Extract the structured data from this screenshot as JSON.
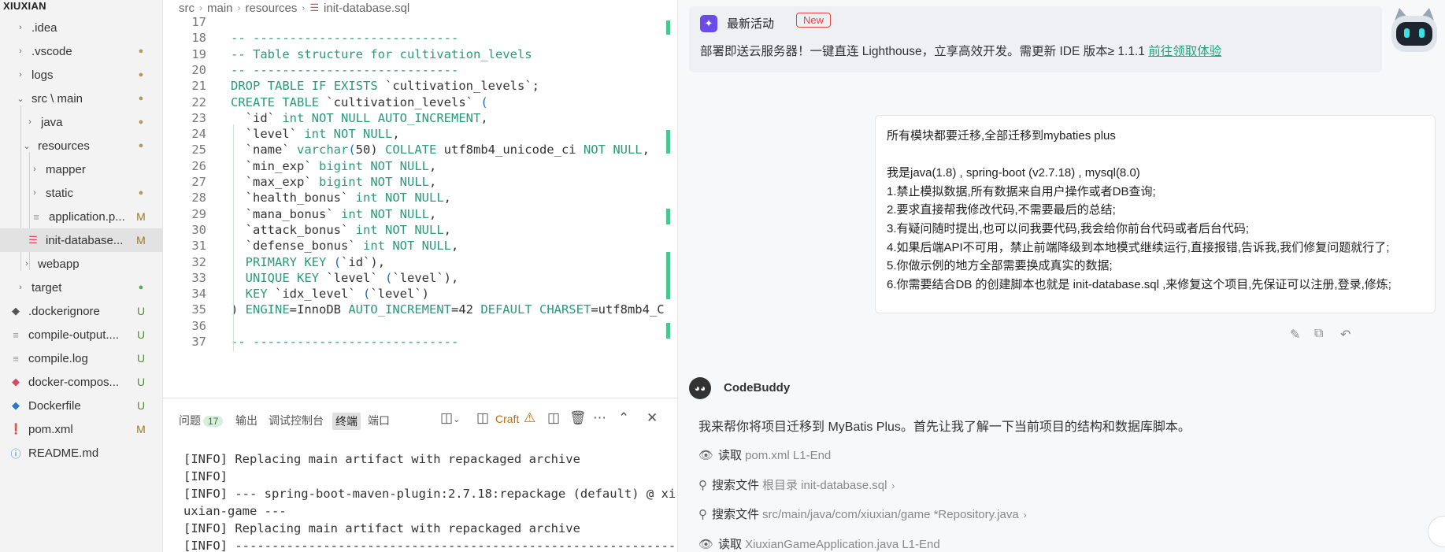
{
  "sidebar": {
    "project_title": "XIUXIAN",
    "items": [
      {
        "label": ".idea",
        "chevron": "›",
        "status": ""
      },
      {
        "label": ".vscode",
        "chevron": "›",
        "status": "●"
      },
      {
        "label": "logs",
        "chevron": "›",
        "status": "●"
      },
      {
        "label": "src \\ main",
        "chevron": "⌄",
        "status": "●"
      },
      {
        "label": "java",
        "chevron": "›",
        "status": "●"
      },
      {
        "label": "resources",
        "chevron": "⌄",
        "status": "●"
      },
      {
        "label": "mapper",
        "chevron": "›",
        "status": ""
      },
      {
        "label": "static",
        "chevron": "›",
        "status": "●"
      },
      {
        "label": "application.p...",
        "icon": "≡",
        "status": "M"
      },
      {
        "label": "init-database...",
        "icon": "≡",
        "status": "M"
      },
      {
        "label": "webapp",
        "chevron": "›",
        "status": ""
      },
      {
        "label": "target",
        "chevron": "›",
        "status": "●"
      },
      {
        "label": ".dockerignore",
        "icon": "🐳",
        "status": "U"
      },
      {
        "label": "compile-output....",
        "icon": "≡",
        "status": "U"
      },
      {
        "label": "compile.log",
        "icon": "≡",
        "status": "U"
      },
      {
        "label": "docker-compos...",
        "icon": "🐳",
        "status": "U"
      },
      {
        "label": "Dockerfile",
        "icon": "🐳",
        "status": "U"
      },
      {
        "label": "pom.xml",
        "icon": "❗",
        "status": "M"
      },
      {
        "label": "README.md",
        "icon": "ⓘ",
        "status": ""
      }
    ]
  },
  "editor": {
    "breadcrumb": [
      "src",
      "main",
      "resources",
      "init-database.sql"
    ],
    "line_numbers": [
      "17",
      "18",
      "19",
      "20",
      "21",
      "22",
      "23",
      "24",
      "25",
      "26",
      "27",
      "28",
      "29",
      "30",
      "31",
      "32",
      "33",
      "34",
      "35",
      "36",
      "37"
    ],
    "lines": [
      "",
      "-- ----------------------------",
      "-- Table structure for cultivation_levels",
      "-- ----------------------------",
      "DROP TABLE IF EXISTS `cultivation_levels`;",
      "CREATE TABLE `cultivation_levels` (",
      "  `id` int NOT NULL AUTO_INCREMENT,",
      "  `level` int NOT NULL,",
      "  `name` varchar(50) COLLATE utf8mb4_unicode_ci NOT NULL,",
      "  `min_exp` bigint NOT NULL,",
      "  `max_exp` bigint NOT NULL,",
      "  `health_bonus` int NOT NULL,",
      "  `mana_bonus` int NOT NULL,",
      "  `attack_bonus` int NOT NULL,",
      "  `defense_bonus` int NOT NULL,",
      "  PRIMARY KEY (`id`),",
      "  UNIQUE KEY `level` (`level`),",
      "  KEY `idx_level` (`level`)",
      ") ENGINE=InnoDB AUTO_INCREMENT=42 DEFAULT CHARSET=utf8mb4_C",
      "",
      "-- ----------------------------"
    ]
  },
  "panel": {
    "tabs": {
      "problems": "问题",
      "problems_count": "17",
      "output": "输出",
      "debug_console": "调试控制台",
      "terminal": "终端",
      "ports": "端口"
    },
    "craft_label": "Craft",
    "terminal_lines": [
      "[INFO] Replacing main artifact with repackaged archive",
      "[INFO]",
      "[INFO] --- spring-boot-maven-plugin:2.7.18:repackage (default) @ xi",
      "uxian-game ---",
      "[INFO] Replacing main artifact with repackaged archive",
      "[INFO] ------------------------------------------------------------"
    ]
  },
  "chat": {
    "promo": {
      "title": "最新活动",
      "badge": "New",
      "text": "部署即送云服务器！一键直连 Lighthouse，立享高效开发。需更新 IDE 版本≥ 1.1.1 ",
      "link": "前往领取体验"
    },
    "user_message": [
      "所有模块都要迁移,全部迁移到mybaties plus",
      "",
      "我是java(1.8) , spring-boot (v2.7.18)  , mysql(8.0)",
      "1.禁止模拟数据,所有数据来自用户操作或者DB查询;",
      "2.要求直接帮我修改代码,不需要最后的总结;",
      "3.有疑问随时提出,也可以问我要代码,我会给你前台代码或者后台代码;",
      "4.如果后端API不可用，禁止前端降级到本地模式继续运行,直接报错,告诉我,我们修复问题就行了;",
      "5.你做示例的地方全部需要换成真实的数据;",
      "6.你需要结合DB 的创建脚本也就是 init-database.sql ,来修复这个项目,先保证可以注册,登录,修炼;"
    ],
    "bot_name": "CodeBuddy",
    "bot_reply": "我来帮你将项目迁移到 MyBatis Plus。首先让我了解一下当前项目的结构和数据库脚本。",
    "steps": [
      {
        "action": "读取",
        "detail": "pom.xml L1-End",
        "icon": "eye-icon"
      },
      {
        "action": "搜索文件",
        "detail": "根目录 init-database.sql",
        "icon": "search-icon"
      },
      {
        "action": "搜索文件",
        "detail": "src/main/java/com/xiuxian/game *Repository.java",
        "icon": "search-icon"
      },
      {
        "action": "读取",
        "detail": "XiuxianGameApplication.java L1-End",
        "icon": "eye-icon"
      }
    ]
  }
}
